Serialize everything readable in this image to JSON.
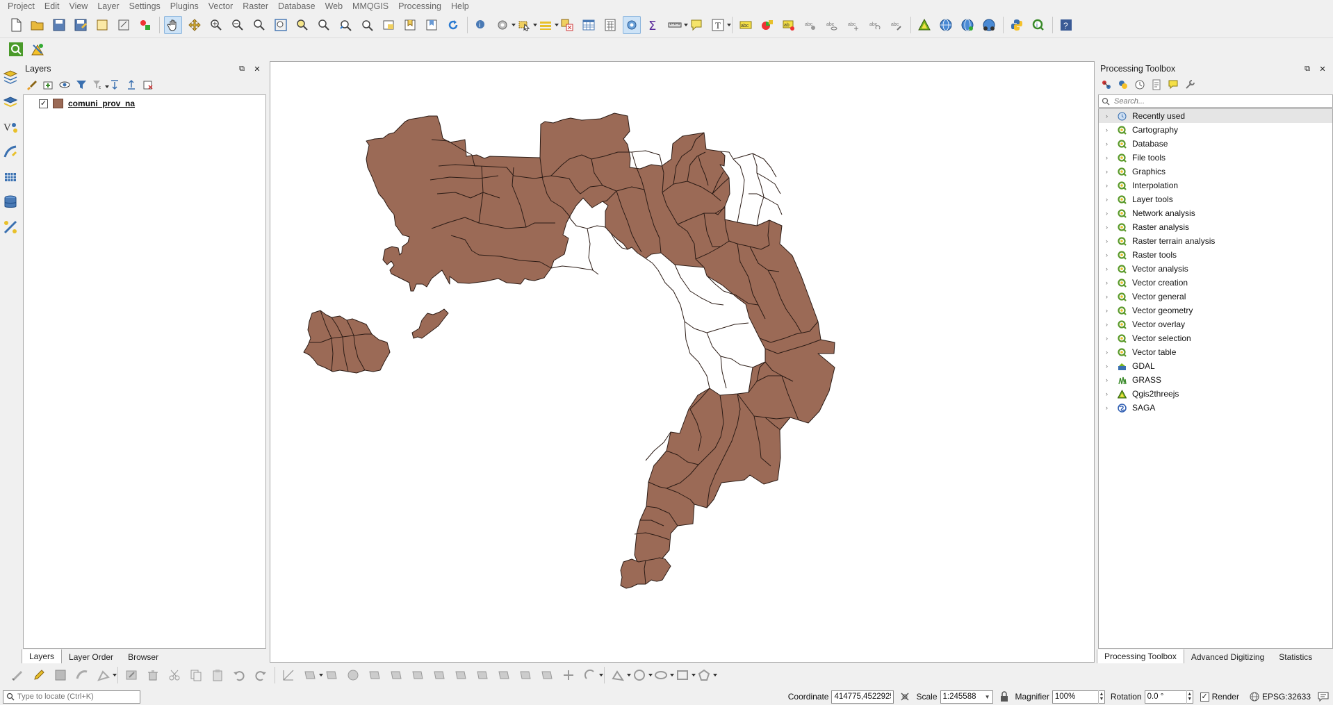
{
  "menu": [
    "Project",
    "Edit",
    "View",
    "Layer",
    "Settings",
    "Plugins",
    "Vector",
    "Raster",
    "Database",
    "Web",
    "MMQGIS",
    "Processing",
    "Help"
  ],
  "layers_panel": {
    "title": "Layers",
    "layers": [
      {
        "name": "comuni_prov_na",
        "checked": true,
        "color": "#9b6a56"
      }
    ],
    "tabs": [
      "Layers",
      "Layer Order",
      "Browser"
    ],
    "active_tab": "Layers"
  },
  "toolbox": {
    "title": "Processing Toolbox",
    "search_placeholder": "Search...",
    "items": [
      {
        "label": "Recently used",
        "icon": "clock-icon"
      },
      {
        "label": "Cartography",
        "icon": "qgis-icon"
      },
      {
        "label": "Database",
        "icon": "qgis-icon"
      },
      {
        "label": "File tools",
        "icon": "qgis-icon"
      },
      {
        "label": "Graphics",
        "icon": "qgis-icon"
      },
      {
        "label": "Interpolation",
        "icon": "qgis-icon"
      },
      {
        "label": "Layer tools",
        "icon": "qgis-icon"
      },
      {
        "label": "Network analysis",
        "icon": "qgis-icon"
      },
      {
        "label": "Raster analysis",
        "icon": "qgis-icon"
      },
      {
        "label": "Raster terrain analysis",
        "icon": "qgis-icon"
      },
      {
        "label": "Raster tools",
        "icon": "qgis-icon"
      },
      {
        "label": "Vector analysis",
        "icon": "qgis-icon"
      },
      {
        "label": "Vector creation",
        "icon": "qgis-icon"
      },
      {
        "label": "Vector general",
        "icon": "qgis-icon"
      },
      {
        "label": "Vector geometry",
        "icon": "qgis-icon"
      },
      {
        "label": "Vector overlay",
        "icon": "qgis-icon"
      },
      {
        "label": "Vector selection",
        "icon": "qgis-icon"
      },
      {
        "label": "Vector table",
        "icon": "qgis-icon"
      },
      {
        "label": "GDAL",
        "icon": "gdal-icon"
      },
      {
        "label": "GRASS",
        "icon": "grass-icon"
      },
      {
        "label": "Qgis2threejs",
        "icon": "threejs-icon"
      },
      {
        "label": "SAGA",
        "icon": "saga-icon"
      }
    ],
    "tabs": [
      "Processing Toolbox",
      "Advanced Digitizing",
      "Statistics"
    ],
    "active_tab": "Processing Toolbox"
  },
  "map": {
    "fill_color": "#9b6a56",
    "stroke_color": "#2b1b15"
  },
  "status": {
    "locator_placeholder": "Type to locate (Ctrl+K)",
    "coordinate_label": "Coordinate",
    "coordinate": "414775,4522925",
    "scale_label": "Scale",
    "scale": "1:245588",
    "magnifier_label": "Magnifier",
    "magnifier": "100%",
    "rotation_label": "Rotation",
    "rotation": "0.0 °",
    "render_label": "Render",
    "render_checked": true,
    "crs": "EPSG:32633"
  }
}
